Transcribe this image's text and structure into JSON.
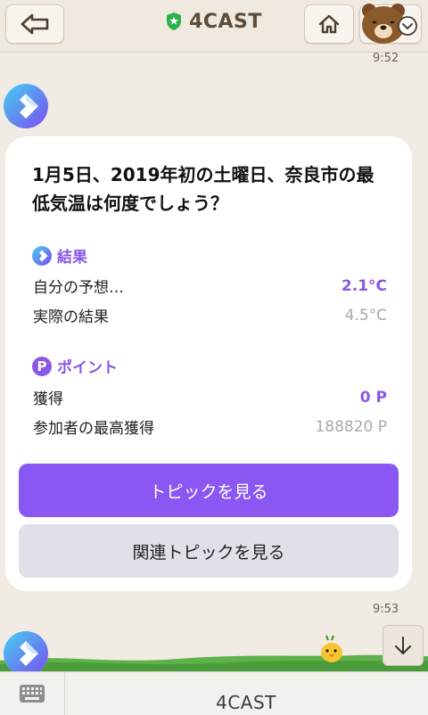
{
  "header": {
    "title": "4CAST",
    "back_icon": "arrow-left-icon",
    "home_icon": "home-icon",
    "menu_icon": "chevron-down-icon"
  },
  "messages": [
    {
      "time": "9:52"
    },
    {
      "time": "9:53"
    }
  ],
  "card": {
    "question": "1月5日、2019年初の土曜日、奈良市の最低気温は何度でしょう？",
    "result": {
      "heading": "結果",
      "rows": [
        {
          "label": "自分の予想…",
          "value": "2.1°C"
        },
        {
          "label": "実際の結果",
          "value": "4.5°C"
        }
      ]
    },
    "points": {
      "heading": "ポイント",
      "icon_letter": "P",
      "rows": [
        {
          "label": "獲得",
          "value": "0 P"
        },
        {
          "label": "参加者の最高獲得",
          "value": "188820 P"
        }
      ]
    },
    "primary_button": "トピックを見る",
    "secondary_button": "関連トピックを見る"
  },
  "footer": {
    "menu_label": "4CAST",
    "keyboard_icon": "keyboard-icon"
  },
  "colors": {
    "accent": "#8a57f2",
    "background": "#f0ebe3",
    "badge_green": "#2bb24c"
  }
}
